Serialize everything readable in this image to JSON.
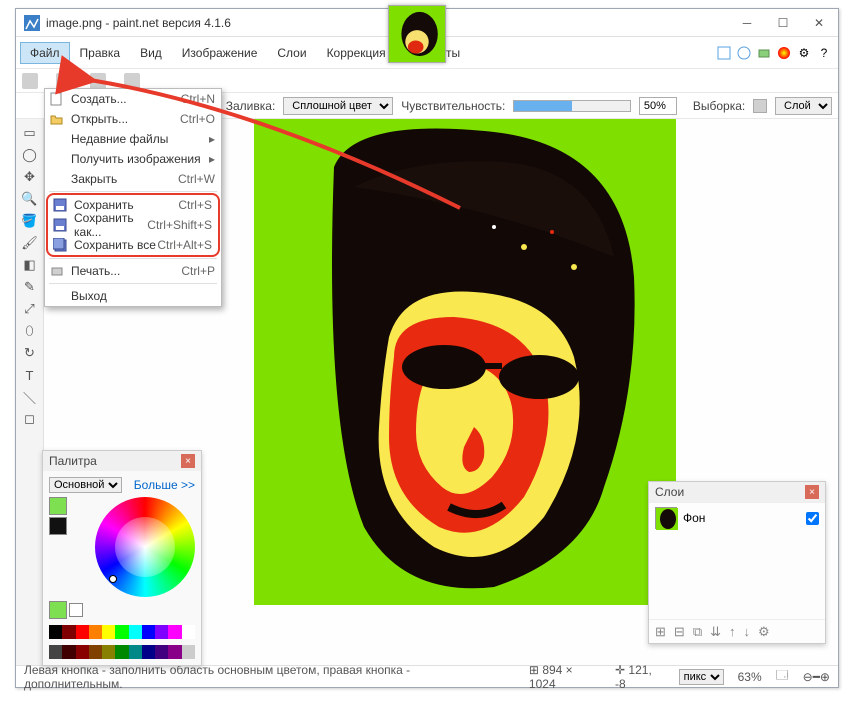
{
  "title": "image.png - paint.net версия 4.1.6",
  "menus": [
    "Файл",
    "Правка",
    "Вид",
    "Изображение",
    "Слои",
    "Коррекция",
    "Эффекты"
  ],
  "titlebar_icons": [
    "tl-icon",
    "tl-icon",
    "tl-icon",
    "tl-icon",
    "gear-icon",
    "help-icon"
  ],
  "toolbar3": {
    "fill_label": "Заливка:",
    "fill_value": "Сплошной цвет",
    "sens_label": "Чувствительность:",
    "sens_value": "50%",
    "sel_label": "Выборка:",
    "sel_value": "Слой"
  },
  "dropdown": {
    "items": [
      {
        "label": "Создать...",
        "shortcut": "Ctrl+N",
        "icon": "new"
      },
      {
        "label": "Открыть...",
        "shortcut": "Ctrl+O",
        "icon": "open"
      },
      {
        "label": "Недавние файлы",
        "arrow": true
      },
      {
        "label": "Получить изображения",
        "arrow": true
      },
      {
        "label": "Закрыть",
        "shortcut": "Ctrl+W"
      }
    ],
    "save_group": [
      {
        "label": "Сохранить",
        "shortcut": "Ctrl+S",
        "icon": "save"
      },
      {
        "label": "Сохранить как...",
        "shortcut": "Ctrl+Shift+S",
        "icon": "saveas"
      },
      {
        "label": "Сохранить все",
        "shortcut": "Ctrl+Alt+S",
        "icon": "saveall"
      }
    ],
    "items2": [
      {
        "label": "Печать...",
        "shortcut": "Ctrl+P",
        "icon": "print"
      }
    ],
    "items3": [
      {
        "label": "Выход"
      }
    ]
  },
  "palette": {
    "title": "Палитра",
    "primary": "Основной",
    "more": "Больше >>"
  },
  "layers": {
    "title": "Слои",
    "item": "Фон"
  },
  "status": {
    "hint": "Левая кнопка - заполнить область основным цветом, правая кнопка - дополнительным.",
    "dims": "894 × 1024",
    "cursor": "121, -8",
    "unit": "пикс",
    "zoom": "63%"
  },
  "colors": {
    "canvas_bg": "#7fe000"
  }
}
